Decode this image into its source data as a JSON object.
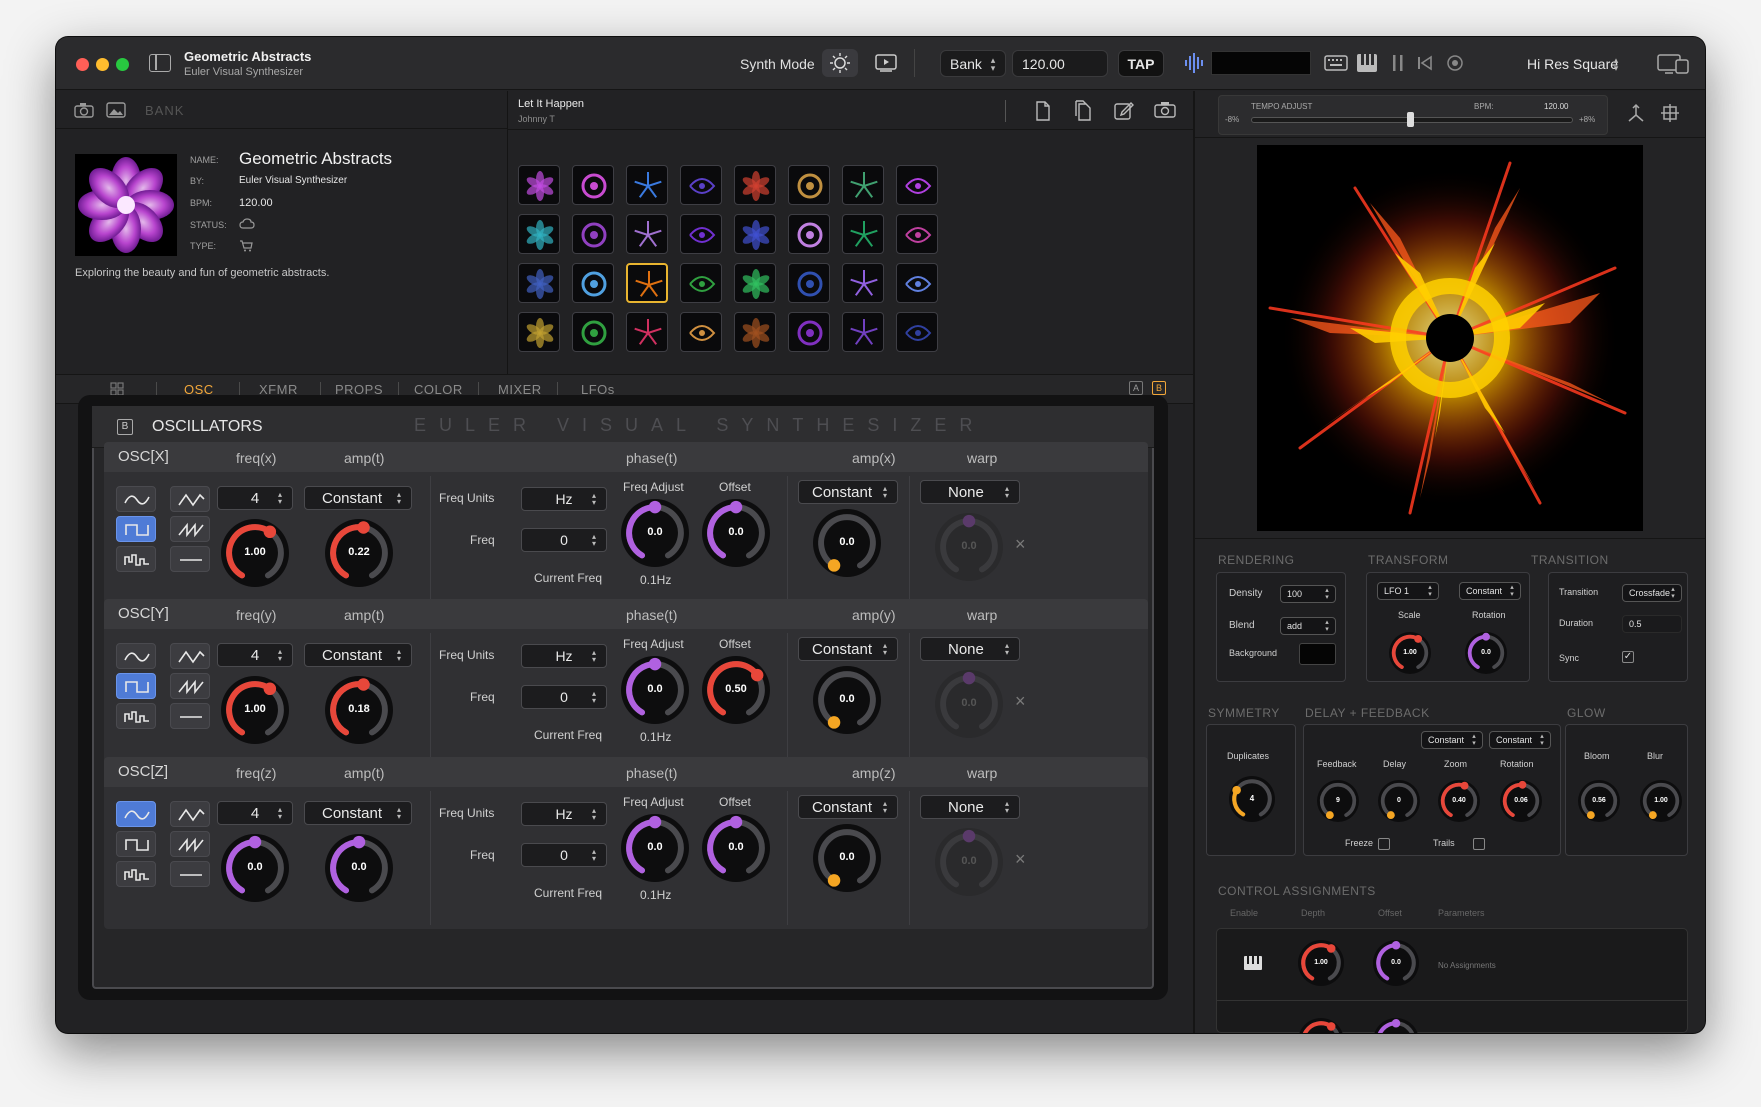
{
  "window": {
    "title": "Geometric Abstracts",
    "subtitle": "Euler Visual Synthesizer"
  },
  "toolbar": {
    "synth_mode_label": "Synth Mode",
    "bank_label": "Bank",
    "bpm_value": "120.00",
    "tap_label": "TAP",
    "resolution_label": "Hi Res Square"
  },
  "left_toolbar": {
    "bank_label": "BANK"
  },
  "song": {
    "title": "Let It Happen",
    "artist": "Johnny T"
  },
  "preset": {
    "name_label": "NAME:",
    "name": "Geometric Abstracts",
    "by_label": "BY:",
    "by": "Euler Visual Synthesizer",
    "bpm_label": "BPM:",
    "bpm": "120.00",
    "status_label": "STATUS:",
    "type_label": "TYPE:",
    "description": "Exploring the beauty and fun of geometric abstracts."
  },
  "tempo": {
    "label": "TEMPO ADJUST",
    "bpm_label": "BPM:",
    "bpm_value": "120.00",
    "min_label": "-8%",
    "max_label": "+8%",
    "position": 0.5
  },
  "tabs": [
    {
      "label": "OSC",
      "active": true
    },
    {
      "label": "XFMR",
      "active": false
    },
    {
      "label": "PROPS",
      "active": false
    },
    {
      "label": "COLOR",
      "active": false
    },
    {
      "label": "MIXER",
      "active": false
    },
    {
      "label": "LFOs",
      "active": false
    }
  ],
  "ab": {
    "a": "A",
    "b": "B"
  },
  "oscillators": {
    "badge": "B",
    "title": "OSCILLATORS",
    "watermark": "EULER VISUAL SYNTHESIZER",
    "labels": {
      "freq_units": "Freq Units",
      "freq": "Freq",
      "freq_adjust": "Freq Adjust",
      "offset": "Offset",
      "current_freq": "Current Freq",
      "phase": "phase(t)",
      "warp": "warp"
    },
    "rows": [
      {
        "name": "OSC[X]",
        "freq_head": "freq(x)",
        "amp_head": "amp(t)",
        "ampx_head": "amp(x)",
        "freq_value": "4",
        "amp_mode": "Constant",
        "freq_units": "Hz",
        "freq": "0",
        "freq_knob": "1.00",
        "amp_knob": "0.22",
        "freq_adjust": "0.0",
        "offset": "0.0",
        "current_freq": "0.1Hz",
        "ampx_mode": "Constant",
        "ampx_knob": "0.0",
        "warp_mode": "None",
        "warp_knob": "0.0"
      },
      {
        "name": "OSC[Y]",
        "freq_head": "freq(y)",
        "amp_head": "amp(t)",
        "ampx_head": "amp(y)",
        "freq_value": "4",
        "amp_mode": "Constant",
        "freq_units": "Hz",
        "freq": "0",
        "freq_knob": "1.00",
        "amp_knob": "0.18",
        "freq_adjust": "0.0",
        "offset": "0.50",
        "current_freq": "0.1Hz",
        "ampx_mode": "Constant",
        "ampx_knob": "0.0",
        "warp_mode": "None",
        "warp_knob": "0.0"
      },
      {
        "name": "OSC[Z]",
        "freq_head": "freq(z)",
        "amp_head": "amp(t)",
        "ampx_head": "amp(z)",
        "freq_value": "4",
        "amp_mode": "Constant",
        "freq_units": "Hz",
        "freq": "0",
        "freq_knob": "0.0",
        "amp_knob": "0.0",
        "freq_adjust": "0.0",
        "offset": "0.0",
        "current_freq": "0.1Hz",
        "ampx_mode": "Constant",
        "ampx_knob": "0.0",
        "warp_mode": "None",
        "warp_knob": "0.0"
      }
    ]
  },
  "rendering": {
    "title": "RENDERING",
    "density_label": "Density",
    "density": "100",
    "blend_label": "Blend",
    "blend": "add",
    "background_label": "Background"
  },
  "transform": {
    "title": "TRANSFORM",
    "src1": "LFO 1",
    "src2": "Constant",
    "scale_label": "Scale",
    "scale": "1.00",
    "rotation_label": "Rotation",
    "rotation": "0.0"
  },
  "transition": {
    "title": "TRANSITION",
    "transition_label": "Transition",
    "transition": "Crossfade",
    "duration_label": "Duration",
    "duration": "0.5",
    "sync_label": "Sync"
  },
  "symmetry": {
    "title": "SYMMETRY",
    "duplicates_label": "Duplicates",
    "duplicates": "4"
  },
  "delay": {
    "title": "DELAY + FEEDBACK",
    "zoom_mode": "Constant",
    "rotation_mode": "Constant",
    "feedback_label": "Feedback",
    "feedback": "9",
    "delay_label": "Delay",
    "delay": "0",
    "zoom_label": "Zoom",
    "zoom": "0.40",
    "rotation_label": "Rotation",
    "rotation": "0.06",
    "freeze_label": "Freeze",
    "trails_label": "Trails"
  },
  "glow": {
    "title": "GLOW",
    "bloom_label": "Bloom",
    "bloom": "0.56",
    "blur_label": "Blur",
    "blur": "1.00"
  },
  "control": {
    "title": "CONTROL ASSIGNMENTS",
    "enable": "Enable",
    "depth": "Depth",
    "offset": "Offset",
    "parameters": "Parameters",
    "depth_value": "1.00",
    "offset_value": "0.0",
    "no_assign": "No Assignments"
  },
  "colors": {
    "accent_orange": "#f2a73a",
    "knob_red": "#e8473a",
    "knob_purple": "#b061e0",
    "knob_orange": "#f5a623",
    "select_blue": "#4f7bd6"
  }
}
